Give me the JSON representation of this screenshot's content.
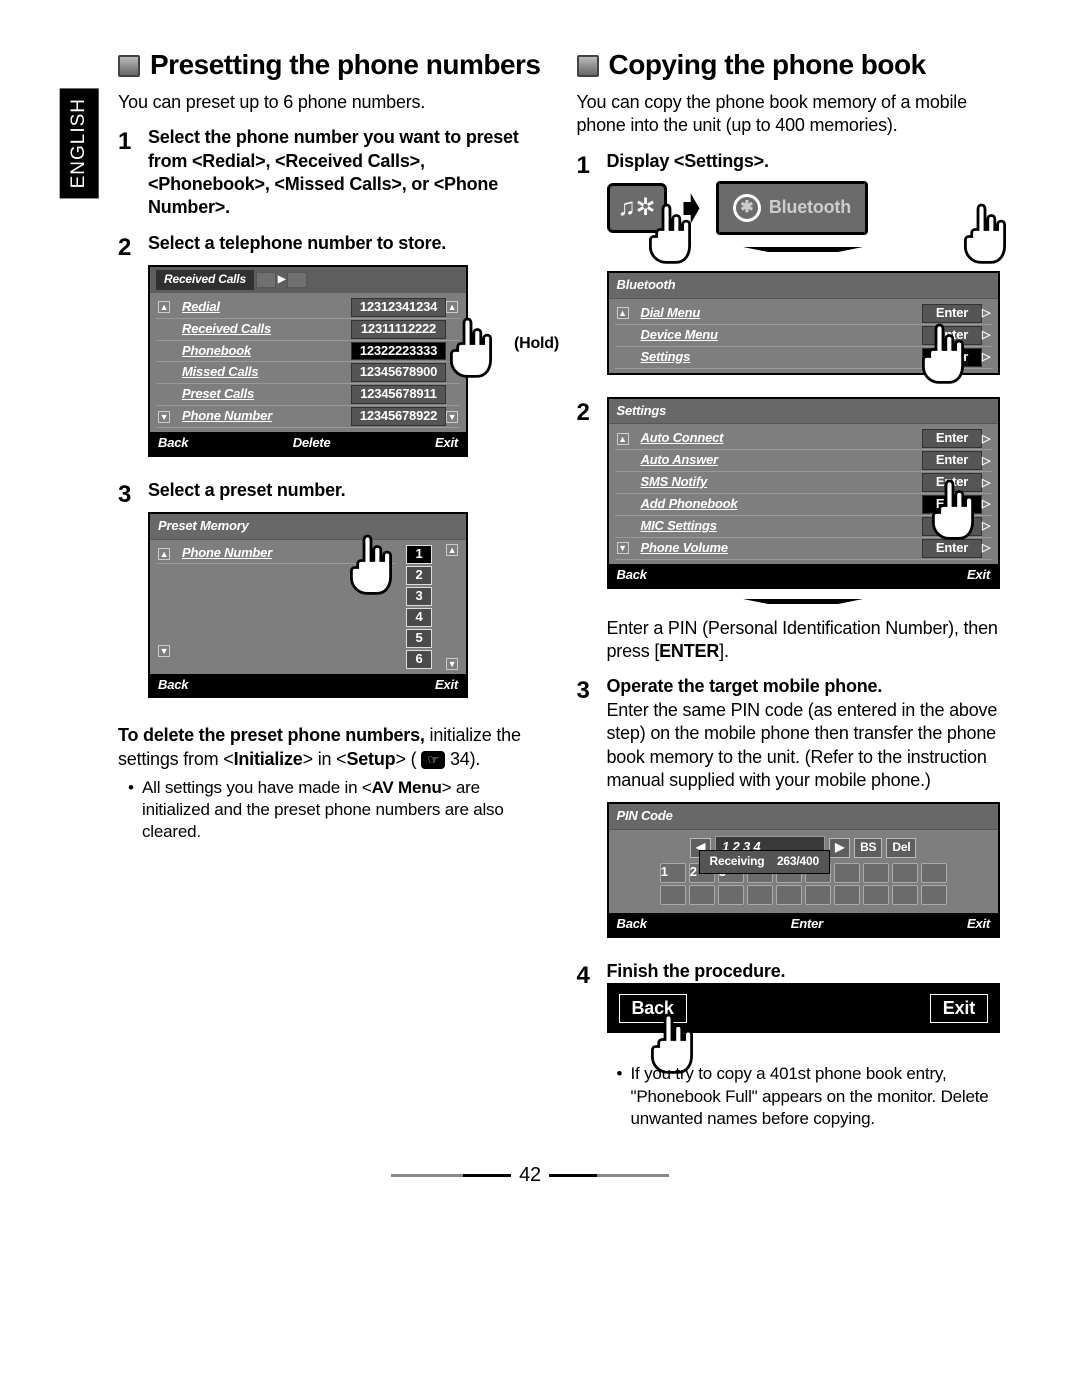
{
  "page_number": "42",
  "lang_tab": "ENGLISH",
  "left": {
    "heading": "Presetting the phone numbers",
    "intro": "You can preset up to 6 phone numbers.",
    "step1": "Select the phone number you want to preset from <Redial>, <Received Calls>, <Phonebook>, <Missed Calls>, or <Phone Number>.",
    "step2": "Select a telephone number to store.",
    "hold_label": "(Hold)",
    "rc_screen": {
      "tab": "Received Calls",
      "rows": [
        {
          "label": "Redial",
          "val": "12312341234"
        },
        {
          "label": "Received Calls",
          "val": "12311112222"
        },
        {
          "label": "Phonebook",
          "val": "12322223333",
          "sel": true
        },
        {
          "label": "Missed Calls",
          "val": "12345678900"
        },
        {
          "label": "Preset Calls",
          "val": "12345678911"
        },
        {
          "label": "Phone Number",
          "val": "12345678922"
        }
      ],
      "back": "Back",
      "delete": "Delete",
      "exit": "Exit"
    },
    "step3": "Select a preset number.",
    "pm_screen": {
      "title": "Preset Memory",
      "label": "Phone Number",
      "slots": [
        "1",
        "2",
        "3",
        "4",
        "5",
        "6"
      ],
      "back": "Back",
      "exit": "Exit"
    },
    "delete_note_bold": "To delete the preset phone numbers,",
    "delete_note_rest": " initialize the settings from <",
    "delete_note_b2": "Initialize",
    "delete_note_r2": "> in <",
    "delete_note_b3": "Setup",
    "delete_note_r3": "> ( ",
    "delete_note_page": " 34).",
    "bullet1a": "All settings you have made in <",
    "bullet1b": "AV Menu",
    "bullet1c": "> are initialized and the preset phone numbers are also cleared."
  },
  "right": {
    "heading": "Copying the phone book",
    "intro": "You can copy the phone book memory of a mobile phone into the unit (up to 400 memories).",
    "step1": "Display <Settings>.",
    "bt_button": "Bluetooth",
    "bt_screen": {
      "title": "Bluetooth",
      "rows": [
        {
          "label": "Dial Menu",
          "btn": "Enter"
        },
        {
          "label": "Device Menu",
          "btn": "Enter"
        },
        {
          "label": "Settings",
          "btn": "Enter",
          "sel": true
        }
      ]
    },
    "set_screen": {
      "title": "Settings",
      "rows": [
        {
          "label": "Auto Connect",
          "btn": "Enter"
        },
        {
          "label": "Auto Answer",
          "btn": "Enter"
        },
        {
          "label": "SMS Notify",
          "btn": "Enter"
        },
        {
          "label": "Add Phonebook",
          "btn": "Enter",
          "sel": true
        },
        {
          "label": "MIC Settings",
          "btn": "Enter"
        },
        {
          "label": "Phone Volume",
          "btn": "Enter"
        }
      ],
      "back": "Back",
      "exit": "Exit"
    },
    "after_step2_a": "Enter a PIN (Personal Identification Number), then press [",
    "after_step2_b": "ENTER",
    "after_step2_c": "].",
    "step3": "Operate the target mobile phone.",
    "step3_body": "Enter the same PIN code (as entered in the above step) on the mobile phone then transfer the phone book memory to the unit. (Refer to the instruction manual supplied with your mobile phone.)",
    "pin_screen": {
      "title": "PIN Code",
      "value": "1 2 3 4",
      "bs": "BS",
      "del": "Del",
      "recv": "Receiving",
      "prog": "263/400",
      "back": "Back",
      "enter": "Enter",
      "exit": "Exit"
    },
    "step4": "Finish the procedure.",
    "bar_back": "Back",
    "bar_exit": "Exit",
    "bullet4": "If you try to copy a 401st phone book entry, \"Phonebook Full\" appears on the monitor. Delete unwanted names before copying."
  }
}
